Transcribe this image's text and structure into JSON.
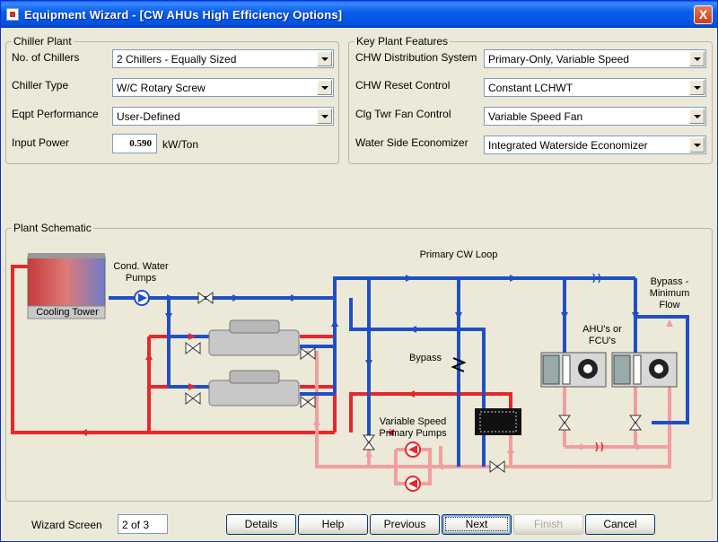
{
  "window": {
    "title": "Equipment Wizard - [CW AHUs High Efficiency Options]",
    "close_glyph": "X"
  },
  "chiller_plant": {
    "title": "Chiller Plant",
    "no_chillers_label": "No. of Chillers",
    "no_chillers_value": "2 Chillers - Equally Sized",
    "chiller_type_label": "Chiller Type",
    "chiller_type_value": "W/C Rotary Screw",
    "eqpt_perf_label": "Eqpt Performance",
    "eqpt_perf_value": "User-Defined",
    "input_power_label": "Input Power",
    "input_power_value": "0.590",
    "input_power_unit": "kW/Ton"
  },
  "key_plant_features": {
    "title": "Key Plant Features",
    "chw_dist_label": "CHW Distribution System",
    "chw_dist_value": "Primary-Only, Variable Speed",
    "chw_reset_label": "CHW Reset Control",
    "chw_reset_value": "Constant LCHWT",
    "clg_twr_label": "Clg Twr Fan Control",
    "clg_twr_value": "Variable Speed Fan",
    "economizer_label": "Water Side Economizer",
    "economizer_value": "Integrated Waterside Economizer"
  },
  "schematic": {
    "title": "Plant Schematic",
    "cooling_tower": "Cooling Tower",
    "cond_pumps_line1": "Cond. Water",
    "cond_pumps_line2": "Pumps",
    "primary_loop": "Primary CW Loop",
    "bypass": "Bypass",
    "bypass_min_line1": "Bypass -",
    "bypass_min_line2": "Minimum",
    "bypass_min_line3": "Flow",
    "ahu_line1": "AHU's or",
    "ahu_line2": "FCU's",
    "vs_pumps_line1": "Variable Speed",
    "vs_pumps_line2": "Primary Pumps"
  },
  "footer": {
    "wizard_screen_label": "Wizard Screen",
    "wizard_screen_value": "2 of 3",
    "details": "Details",
    "help": "Help",
    "previous": "Previous",
    "next": "Next",
    "finish": "Finish",
    "cancel": "Cancel"
  },
  "colors": {
    "supply": "#1F4FC8",
    "return_hot": "#E8262B",
    "return_warm": "#F29EA0",
    "title_bar": "#0A5FEB"
  }
}
